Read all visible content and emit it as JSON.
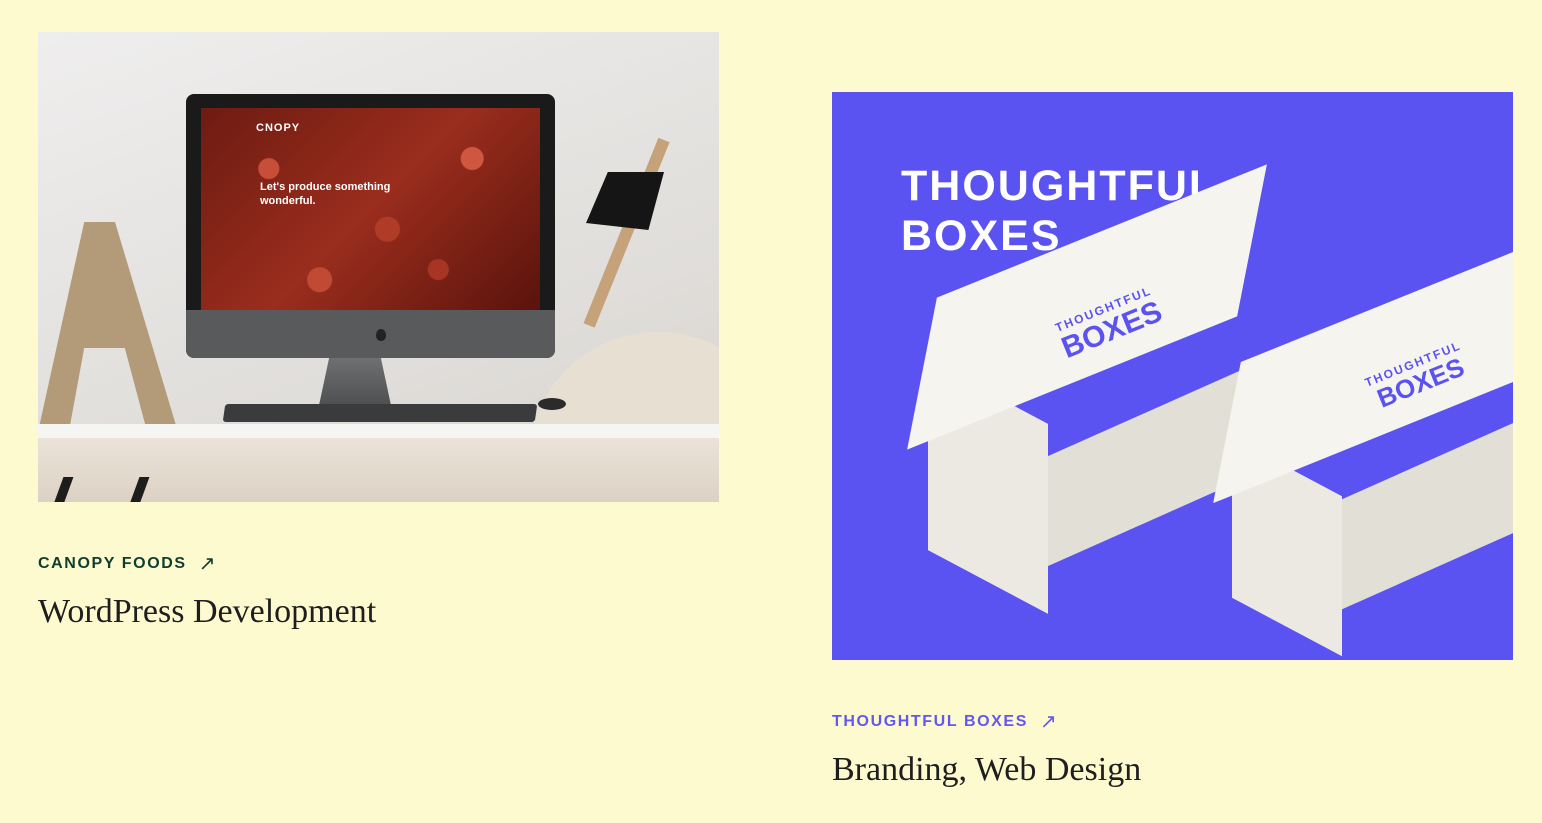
{
  "cards": [
    {
      "eyebrow": "CANOPY FOODS",
      "arrow": "↗",
      "subtitle": "WordPress Development",
      "image": {
        "screen_brand": "CNOPY",
        "screen_headline": "Let's produce something wonderful."
      }
    },
    {
      "eyebrow": "THOUGHTFUL BOXES",
      "arrow": "↗",
      "subtitle": "Branding, Web Design",
      "image": {
        "headline_line1": "THOUGHTFUL",
        "headline_line2": "BOXES",
        "box_logo_top": "THOUGHTFUL",
        "box_logo_bottom": "BOXES"
      }
    }
  ],
  "colors": {
    "background": "#fefad0",
    "canopy_green": "#0f3d2e",
    "thoughtful_purple": "#5b53f1"
  }
}
